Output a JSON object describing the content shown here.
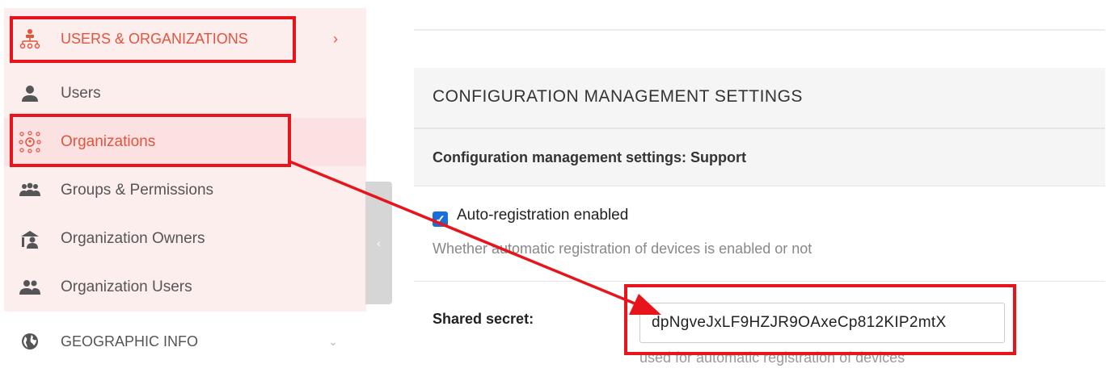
{
  "sidebar": {
    "group": {
      "label": "USERS & ORGANIZATIONS",
      "chevron": "›",
      "icon": "org-tree-icon"
    },
    "items": [
      {
        "label": "Users",
        "icon": "user-icon"
      },
      {
        "label": "Organizations",
        "icon": "organizations-icon"
      },
      {
        "label": "Groups & Permissions",
        "icon": "groups-icon"
      },
      {
        "label": "Organization Owners",
        "icon": "owner-icon"
      },
      {
        "label": "Organization Users",
        "icon": "org-users-icon"
      }
    ],
    "geo": {
      "label": "GEOGRAPHIC INFO",
      "chevron": "⌄",
      "icon": "globe-icon"
    },
    "collapse_glyph": "‹"
  },
  "main": {
    "panel_title": "CONFIGURATION MANAGEMENT SETTINGS",
    "section_title": "Configuration management settings: Support",
    "auto_registration": {
      "label": "Auto-registration enabled",
      "checked": true,
      "help": "Whether automatic registration of devices is enabled or not"
    },
    "shared_secret": {
      "label": "Shared secret:",
      "value": "dpNgveJxLF9HZJR9OAxeCp812KIP2mtX",
      "help": "used for automatic registration of devices"
    }
  },
  "colors": {
    "accent": "#e5533b",
    "annotation": "#e8141c",
    "checkbox": "#1a6fd8"
  }
}
